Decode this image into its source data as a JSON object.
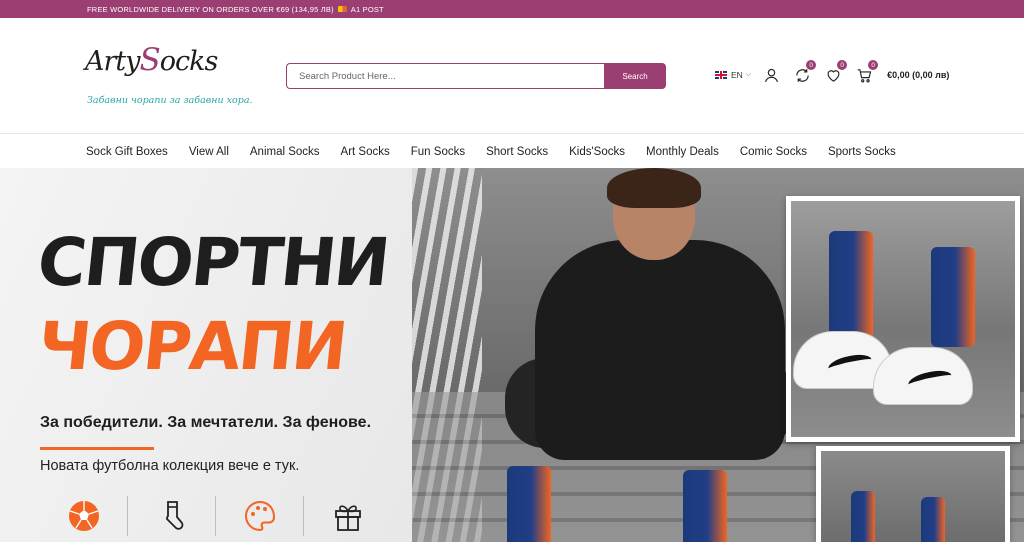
{
  "topbar": {
    "text": "FREE WORLDWIDE DELIVERY ON ORDERS OVER €69 (134,95 ЛВ)",
    "carrier": "A1 POST"
  },
  "logo": {
    "brand": "ArtySocks",
    "tagline": "Забавни чорапи за забавни хора."
  },
  "search": {
    "placeholder": "Search Product Here...",
    "button_label": "Search"
  },
  "header_tools": {
    "language": "EN",
    "compare_count": "0",
    "wishlist_count": "0",
    "cart_count": "0",
    "cart_total": "€0,00 (0,00 лв)"
  },
  "nav": {
    "items": [
      "Sock Gift Boxes",
      "View All",
      "Animal Socks",
      "Art Socks",
      "Fun Socks",
      "Short Socks",
      "Kids'Socks",
      "Monthly Deals",
      "Comic Socks",
      "Sports Socks"
    ]
  },
  "hero": {
    "headline_line1": "СПОРТНИ",
    "headline_line2": "ЧОРАПИ",
    "subtitle": "За победители. За мечтатели. За фенове.",
    "subtitle2": "Новата футболна колекция вече е тук.",
    "icons": [
      "football-icon",
      "sock-icon",
      "palette-icon",
      "gift-icon"
    ]
  },
  "colors": {
    "brand": "#9b3f72",
    "accent": "#f26522",
    "teal": "#2aa6a6"
  }
}
